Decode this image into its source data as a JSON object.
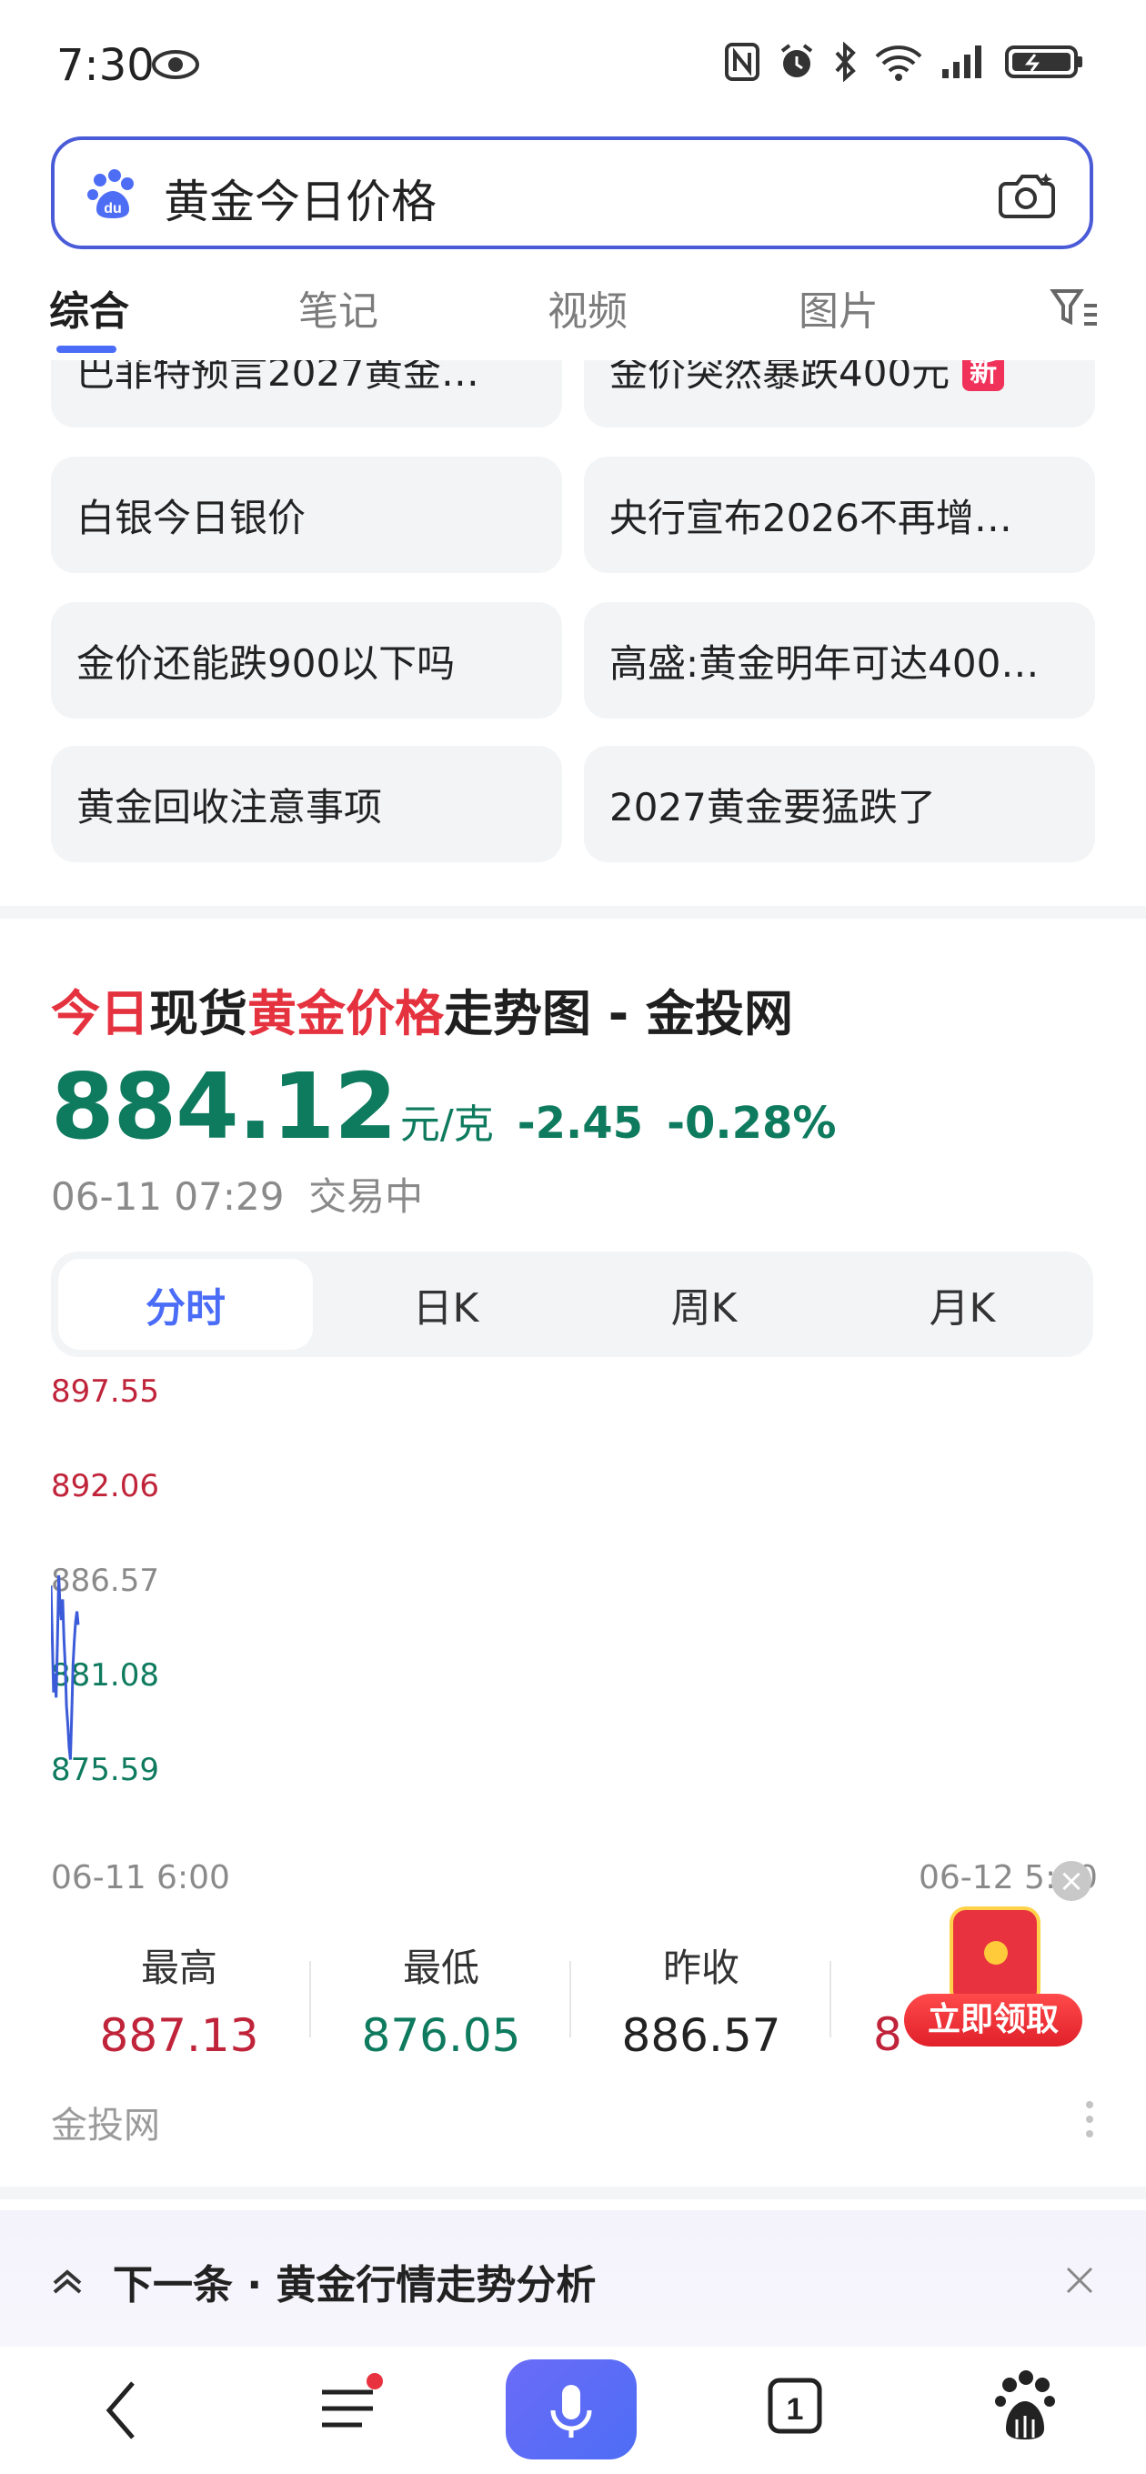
{
  "status_bar": {
    "time": "7:30"
  },
  "search": {
    "query": "黄金今日价格"
  },
  "tabs": [
    "综合",
    "笔记",
    "视频",
    "图片"
  ],
  "suggestions": [
    {
      "text": "巴菲特预言2027黄金…",
      "badge": ""
    },
    {
      "text": "金价突然暴跌400元",
      "badge": "新"
    },
    {
      "text": "白银今日银价",
      "badge": ""
    },
    {
      "text": "央行宣布2026不再增…",
      "badge": ""
    },
    {
      "text": "金价还能跌900以下吗",
      "badge": ""
    },
    {
      "text": "高盛:黄金明年可达400…",
      "badge": ""
    },
    {
      "text": "黄金回收注意事项",
      "badge": ""
    },
    {
      "text": "2027黄金要猛跌了",
      "badge": ""
    }
  ],
  "card": {
    "title_part1": "今日",
    "title_part2": "现货",
    "title_part3": "黄金价格",
    "title_part4": "走势图 - 金投网",
    "price": "884.12",
    "unit": "元/克",
    "change": "-2.45",
    "change_pct": "-0.28%",
    "timestamp": "06-11 07:29",
    "trading_status": "交易中",
    "kline_tabs": [
      "分时",
      "日K",
      "周K",
      "月K"
    ],
    "stats": [
      {
        "label": "最高",
        "value": "887.13",
        "color": "#c0243a"
      },
      {
        "label": "最低",
        "value": "876.05",
        "color": "#0e7a5e"
      },
      {
        "label": "昨收",
        "value": "886.57",
        "color": "#222222"
      }
    ],
    "stats_partial_value": "8",
    "promo_label": "立即领取",
    "source": "金投网"
  },
  "chart_data": {
    "type": "line",
    "y_ticks": [
      "897.55",
      "892.06",
      "886.57",
      "881.08",
      "875.59"
    ],
    "ylim": [
      875.59,
      897.55
    ],
    "x_ticks": [
      "06-11 6:00",
      "06-12 5:00"
    ],
    "baseline": 886.57,
    "x": [
      0,
      1,
      2,
      3,
      4,
      5,
      6,
      7,
      8,
      9,
      10,
      11,
      12,
      13,
      14,
      15,
      16,
      17,
      18,
      19,
      20,
      21
    ],
    "values": [
      886.4,
      883.5,
      880.2,
      881.3,
      879.9,
      883.0,
      887.0,
      885.2,
      884.4,
      885.6,
      883.3,
      881.8,
      879.4,
      878.3,
      877.0,
      876.3,
      879.0,
      881.8,
      883.2,
      884.3,
      884.9,
      884.12
    ],
    "line_color": "#3b5bd9",
    "up_color": "#c0243a",
    "down_color": "#0e7a5e"
  },
  "next_bar": {
    "text": "下一条 · 黄金行情走势分析"
  },
  "bottom_nav": {
    "tabs_count": "1"
  },
  "colors": {
    "accent": "#4a6cf7",
    "up": "#c0243a",
    "down": "#0e7a5e",
    "title_highlight": "#e5323f"
  }
}
